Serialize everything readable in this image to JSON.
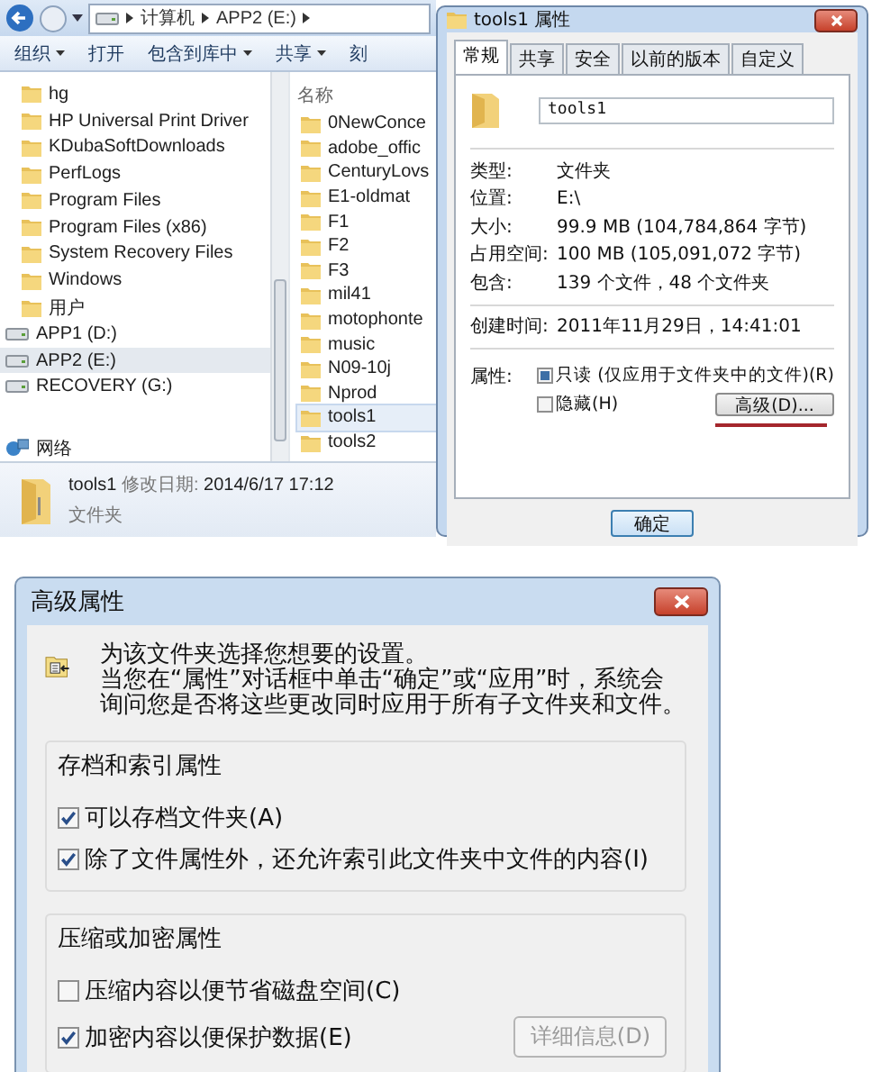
{
  "explorer": {
    "breadcrumb": [
      "计算机",
      "APP2 (E:)"
    ],
    "toolbar": [
      {
        "label": "组织",
        "dropdown": true
      },
      {
        "label": "打开",
        "dropdown": false
      },
      {
        "label": "包含到库中",
        "dropdown": true
      },
      {
        "label": "共享",
        "dropdown": true
      },
      {
        "label": "刻",
        "dropdown": false
      }
    ],
    "nav_items": [
      {
        "kind": "folder",
        "label": "hg",
        "selected": false
      },
      {
        "kind": "folder",
        "label": "HP Universal Print Driver",
        "selected": false
      },
      {
        "kind": "folder",
        "label": "KDubaSoftDownloads",
        "selected": false
      },
      {
        "kind": "folder",
        "label": "PerfLogs",
        "selected": false
      },
      {
        "kind": "folder",
        "label": "Program Files",
        "selected": false
      },
      {
        "kind": "folder",
        "label": "Program Files (x86)",
        "selected": false
      },
      {
        "kind": "folder",
        "label": "System Recovery Files",
        "selected": false
      },
      {
        "kind": "folder",
        "label": "Windows",
        "selected": false
      },
      {
        "kind": "folder",
        "label": "用户",
        "selected": false
      },
      {
        "kind": "drive",
        "label": "APP1 (D:)",
        "selected": false
      },
      {
        "kind": "drive",
        "label": "APP2 (E:)",
        "selected": true
      },
      {
        "kind": "drive",
        "label": "RECOVERY (G:)",
        "selected": false
      },
      {
        "kind": "network",
        "label": "网络",
        "selected": false
      }
    ],
    "file_list": {
      "column": "名称",
      "items": [
        {
          "label": "0NewConce",
          "selected": false
        },
        {
          "label": "adobe_offic",
          "selected": false
        },
        {
          "label": "CenturyLovs",
          "selected": false
        },
        {
          "label": "E1-oldmat",
          "selected": false
        },
        {
          "label": "F1",
          "selected": false
        },
        {
          "label": "F2",
          "selected": false
        },
        {
          "label": "F3",
          "selected": false
        },
        {
          "label": "mil41",
          "selected": false
        },
        {
          "label": "motophonte",
          "selected": false
        },
        {
          "label": "music",
          "selected": false
        },
        {
          "label": "N09-10j",
          "selected": false
        },
        {
          "label": "Nprod",
          "selected": false
        },
        {
          "label": "tools1",
          "selected": true
        },
        {
          "label": "tools2",
          "selected": false
        }
      ]
    },
    "details": {
      "name": "tools1",
      "modified_label": "修改日期:",
      "modified": "2014/6/17 17:12",
      "type": "文件夹"
    }
  },
  "properties": {
    "title": "tools1 属性",
    "tabs": [
      {
        "label": "常规",
        "selected": true
      },
      {
        "label": "共享",
        "selected": false
      },
      {
        "label": "安全",
        "selected": false
      },
      {
        "label": "以前的版本",
        "selected": false
      },
      {
        "label": "自定义",
        "selected": false
      }
    ],
    "name_value": "tools1",
    "info_rows": [
      {
        "label": "类型:",
        "value": "文件夹"
      },
      {
        "label": "位置:",
        "value": "E:\\"
      },
      {
        "label": "大小:",
        "value": "99.9 MB (104,784,864 字节)"
      },
      {
        "label": "占用空间:",
        "value": "100 MB (105,091,072 字节)"
      },
      {
        "label": "包含:",
        "value": "139 个文件，48 个文件夹"
      }
    ],
    "created": {
      "label": "创建时间:",
      "value": "2011年11月29日，14:41:01"
    },
    "attributes_label": "属性:",
    "attributes": [
      {
        "label": "只读 (仅应用于文件夹中的文件)(R)",
        "checked": true,
        "mixed": true
      },
      {
        "label": "隐藏(H)",
        "checked": false,
        "mixed": false
      }
    ],
    "advanced_button": "高级(D)...",
    "ok_button": "确定"
  },
  "advanced": {
    "title": "高级属性",
    "description": [
      "为该文件夹选择您想要的设置。",
      "当您在“属性”对话框中单击“确定”或“应用”时，系统会询问您是否将这些更改同时应用于所有子文件夹和文件。"
    ],
    "groups": [
      {
        "title": "存档和索引属性",
        "options": [
          {
            "label": "可以存档文件夹(A)",
            "checked": true
          },
          {
            "label": "除了文件属性外，还允许索引此文件夹中文件的内容(I)",
            "checked": true
          }
        ]
      },
      {
        "title": "压缩或加密属性",
        "options": [
          {
            "label": "压缩内容以便节省磁盘空间(C)",
            "checked": false
          },
          {
            "label": "加密内容以便保护数据(E)",
            "checked": true
          }
        ]
      }
    ],
    "details_button": {
      "label": "详细信息(D)",
      "disabled": true
    }
  }
}
